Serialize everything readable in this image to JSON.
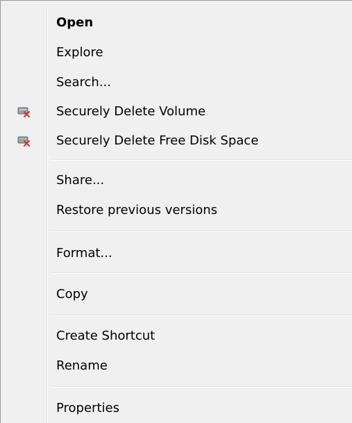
{
  "menu": {
    "items": [
      {
        "label": "Open"
      },
      {
        "label": "Explore"
      },
      {
        "label": "Search..."
      },
      {
        "label": "Securely Delete Volume",
        "icon": "drive-delete-icon"
      },
      {
        "label": "Securely Delete Free Disk Space",
        "icon": "drive-delete-icon"
      },
      {
        "label": "Share..."
      },
      {
        "label": "Restore previous versions"
      },
      {
        "label": "Format..."
      },
      {
        "label": "Copy"
      },
      {
        "label": "Create Shortcut"
      },
      {
        "label": "Rename"
      },
      {
        "label": "Properties"
      }
    ]
  },
  "colors": {
    "menu_background": "#f0f0f0",
    "separator": "#e0e0e0",
    "icon_x": "#d9342b"
  }
}
